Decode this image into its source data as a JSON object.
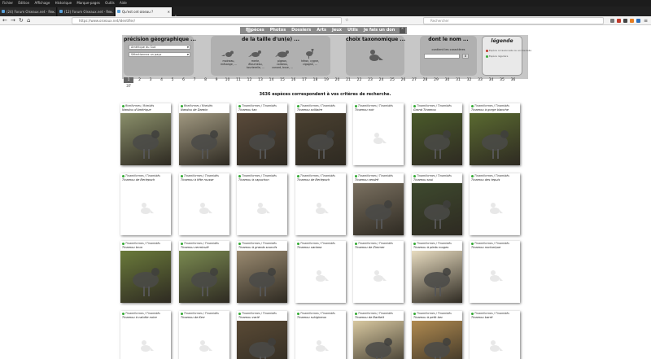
{
  "browser": {
    "menu": [
      "Fichier",
      "Édition",
      "Affichage",
      "Historique",
      "Marque-pages",
      "Outils",
      "Aide"
    ],
    "tabs": [
      {
        "label": "(24) Forum Oiseaux.net - Re..."
      },
      {
        "label": "(12) Forum Oiseaux.net - Re..."
      },
      {
        "label": "Qu'est cet oiseau ?"
      }
    ],
    "url": "https://www.oiseaux.net/identifier/",
    "search_placeholder": "Rechercher"
  },
  "site_nav": [
    "Espèces",
    "Photos",
    "Dossiers",
    "Arts",
    "Jeux",
    "Utils",
    "Je fais un don"
  ],
  "filters": {
    "precision": {
      "title": "précision géographique ...",
      "select1": "Amérique du Sud",
      "select2": "Sélectionnez un pays"
    },
    "size": {
      "title": "de la taille d'un(e) ...",
      "options": [
        {
          "label": "moineau, mésange, ..."
        },
        {
          "label": "merle, étourneau, tourterelle, ..."
        },
        {
          "label": "pigeon, corbeau, canard, buse, ..."
        },
        {
          "label": "héron, cygne, cigogne, ..."
        }
      ]
    },
    "taxonomy": {
      "title": "choix taxonomique ..."
    },
    "name": {
      "title": "dont le nom ...",
      "contains_label": "contient les caractères",
      "clear": "x"
    },
    "legend": {
      "title": "légende",
      "items": [
        {
          "label": "Espèce occasionnelle ou accidentelle",
          "color": "#c0392b"
        },
        {
          "label": "Espèce régulière",
          "color": "#3aaa3a"
        }
      ]
    }
  },
  "pagination": {
    "pages": [
      "1",
      "2",
      "3",
      "4",
      "5",
      "6",
      "7",
      "8",
      "9",
      "10",
      "11",
      "12",
      "13",
      "14",
      "15",
      "16",
      "17",
      "18",
      "19",
      "20",
      "21",
      "22",
      "23",
      "24",
      "25",
      "26",
      "27",
      "28",
      "29",
      "30",
      "31",
      "32",
      "33",
      "34",
      "35",
      "36",
      "37"
    ],
    "current": "1"
  },
  "result_count": "3636 espèces correspondent à vos critères de recherche.",
  "species": [
    {
      "order": "Rheiformes / Rheidés",
      "name": "Nandou d'Amérique",
      "photo": true,
      "bg": "#8a8f6a"
    },
    {
      "order": "Rheiformes / Rheidés",
      "name": "Nandou de Darwin",
      "photo": true,
      "bg": "#a09880"
    },
    {
      "order": "Tinamiformes / Tinamidés",
      "name": "Tinamou tao",
      "photo": true,
      "bg": "#5a4a3a"
    },
    {
      "order": "Tinamiformes / Tinamidés",
      "name": "Tinamou solitaire",
      "photo": true,
      "bg": "#4a4030"
    },
    {
      "order": "Tinamiformes / Tinamidés",
      "name": "Tinamou noir",
      "photo": false
    },
    {
      "order": "Tinamiformes / Tinamidés",
      "name": "Grand Tinamou",
      "photo": true,
      "bg": "#4a5a2a"
    },
    {
      "order": "Tinamiformes / Tinamidés",
      "name": "Tinamou à gorge blanche",
      "photo": true,
      "bg": "#5a6a30"
    },
    {
      "order": "Tinamiformes / Tinamidés",
      "name": "Tinamou de Berlepsch",
      "photo": false
    },
    {
      "order": "Tinamiformes / Tinamidés",
      "name": "Tinamou à tête rousse",
      "photo": false
    },
    {
      "order": "Tinamiformes / Tinamidés",
      "name": "Tinamou à capuchon",
      "photo": false
    },
    {
      "order": "Tinamiformes / Tinamidés",
      "name": "Tinamou de Berlepsch",
      "photo": false
    },
    {
      "order": "Tinamiformes / Tinamidés",
      "name": "Tinamou cendré",
      "photo": true,
      "bg": "#7a7060"
    },
    {
      "order": "Tinamiformes / Tinamidés",
      "name": "Tinamou soui",
      "photo": true,
      "bg": "#3e4a2e"
    },
    {
      "order": "Tinamiformes / Tinamidés",
      "name": "Tinamou des tepuis",
      "photo": false
    },
    {
      "order": "Tinamiformes / Tinamidés",
      "name": "Tinamou brun",
      "photo": true,
      "bg": "#6a7a3a"
    },
    {
      "order": "Tinamiformes / Tinamidés",
      "name": "Tinamou vermiculé",
      "photo": true,
      "bg": "#7a8a50"
    },
    {
      "order": "Tinamiformes / Tinamidés",
      "name": "Tinamou à grands sourcils",
      "photo": true,
      "bg": "#9a8a70"
    },
    {
      "order": "Tinamiformes / Tinamidés",
      "name": "Tinamou oariana",
      "photo": false
    },
    {
      "order": "Tinamiformes / Tinamidés",
      "name": "Tinamou de Zimmer",
      "photo": false
    },
    {
      "order": "Tinamiformes / Tinamidés",
      "name": "Tinamou à pieds rouges",
      "photo": true,
      "bg": "#e8dcc0"
    },
    {
      "order": "Tinamiformes / Tinamidés",
      "name": "Tinamou nocturique",
      "photo": false
    },
    {
      "order": "Tinamiformes / Tinamidés",
      "name": "Tinamou à calotte noire",
      "photo": false
    },
    {
      "order": "Tinamiformes / Tinamidés",
      "name": "Tinamou de Kerr",
      "photo": false
    },
    {
      "order": "Tinamiformes / Tinamidés",
      "name": "Tinamou varié",
      "photo": true,
      "bg": "#5a4a35"
    },
    {
      "order": "Tinamiformes / Tinamidés",
      "name": "Tinamou rubigineux",
      "photo": false
    },
    {
      "order": "Tinamiformes / Tinamidés",
      "name": "Tinamou de Bartlett",
      "photo": true,
      "bg": "#d8c8a0"
    },
    {
      "order": "Tinamiformes / Tinamidés",
      "name": "Tinamou à petit bec",
      "photo": true,
      "bg": "#b08a50"
    },
    {
      "order": "Tinamiformes / Tinamidés",
      "name": "Tinamou barré",
      "photo": false
    }
  ]
}
